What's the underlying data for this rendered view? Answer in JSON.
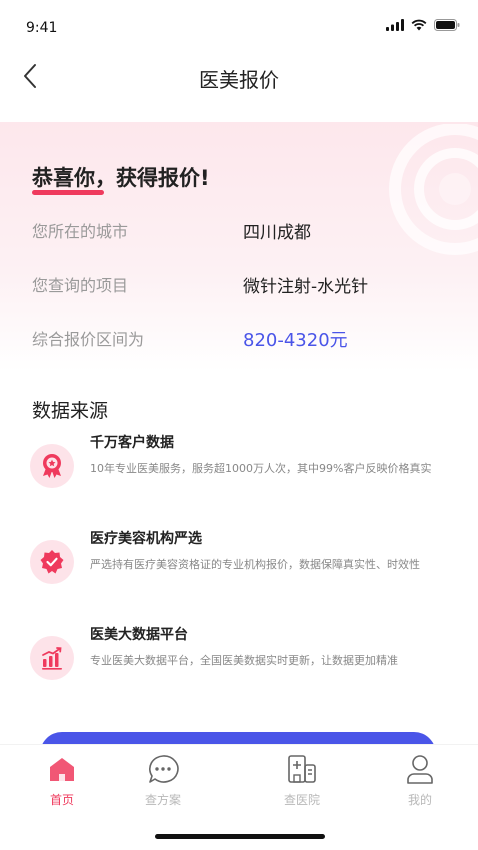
{
  "status_bar": {
    "time": "9:41"
  },
  "nav": {
    "title": "医美报价"
  },
  "quote": {
    "congrats": "恭喜你，获得报价!",
    "rows": [
      {
        "label": "您所在的城市",
        "value": "四川成都"
      },
      {
        "label": "您查询的项目",
        "value": "微针注射-水光针"
      },
      {
        "label": "综合报价区间为",
        "value": "820-4320元"
      }
    ]
  },
  "sources": {
    "title": "数据来源",
    "items": [
      {
        "icon": "award-ribbon-icon",
        "title": "千万客户数据",
        "desc": "10年专业医美服务，服务超1000万人次，其中99%客户反映价格真实"
      },
      {
        "icon": "verified-badge-icon",
        "title": "医疗美容机构严选",
        "desc": "严选持有医疗美容资格证的专业机构报价，数据保障真实性、时效性"
      },
      {
        "icon": "bar-chart-trend-icon",
        "title": "医美大数据平台",
        "desc": "专业医美大数据平台，全国医美数据实时更新，让数据更加精准"
      }
    ]
  },
  "tabs": [
    {
      "label": "首页",
      "icon": "home-icon",
      "active": true
    },
    {
      "label": "查方案",
      "icon": "chat-bubble-icon",
      "active": false
    },
    {
      "label": "查医院",
      "icon": "hospital-icon",
      "active": false
    },
    {
      "label": "我的",
      "icon": "user-icon",
      "active": false
    }
  ],
  "colors": {
    "accent_pink": "#ef3a5d",
    "accent_blue": "#4a55e8",
    "hero_bg": "#fde7ec"
  }
}
